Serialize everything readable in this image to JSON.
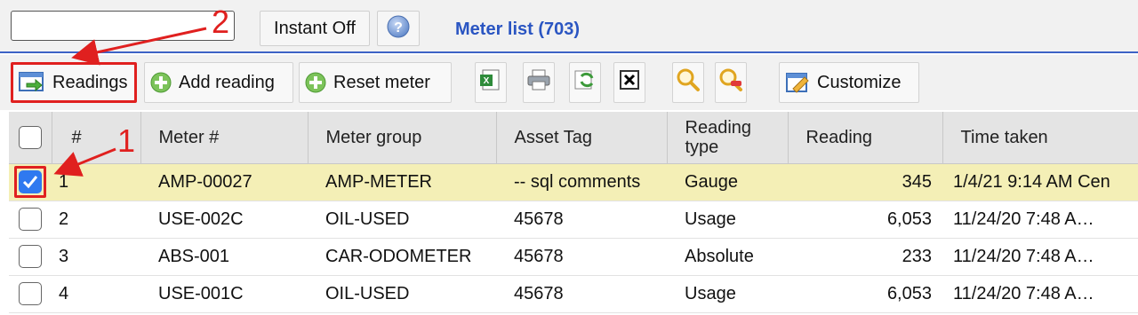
{
  "search": {
    "value": "",
    "placeholder": ""
  },
  "topbar": {
    "instant_label": "Instant Off",
    "help_icon": "help-icon",
    "title": "Meter list (703)"
  },
  "toolbar": {
    "readings_label": "Readings",
    "add_reading_label": "Add reading",
    "reset_meter_label": "Reset meter",
    "customize_label": "Customize",
    "icons": [
      "excel-export-icon",
      "print-icon",
      "refresh-icon",
      "close-icon",
      "search-icon",
      "clear-search-icon",
      "customize-icon"
    ]
  },
  "grid": {
    "columns": [
      "#",
      "Meter #",
      "Meter group",
      "Asset Tag",
      "Reading type",
      "Reading",
      "Time taken"
    ],
    "rows": [
      {
        "index": "1",
        "meter": "AMP-00027",
        "group": "AMP-METER",
        "asset": "-- sql comments",
        "type": "Gauge",
        "reading": "345",
        "time": "1/4/21 9:14 AM Cen",
        "checked": true
      },
      {
        "index": "2",
        "meter": "USE-002C",
        "group": "OIL-USED",
        "asset": "45678",
        "type": "Usage",
        "reading": "6,053",
        "time": "11/24/20 7:48 A…",
        "checked": false
      },
      {
        "index": "3",
        "meter": "ABS-001",
        "group": "CAR-ODOMETER",
        "asset": "45678",
        "type": "Absolute",
        "reading": "233",
        "time": "11/24/20 7:48 A…",
        "checked": false
      },
      {
        "index": "4",
        "meter": "USE-001C",
        "group": "OIL-USED",
        "asset": "45678",
        "type": "Usage",
        "reading": "6,053",
        "time": "11/24/20 7:48 A…",
        "checked": false
      }
    ]
  },
  "annotations": {
    "step1": "1",
    "step2": "2"
  },
  "colors": {
    "accent": "#2a55c2",
    "highlight": "#e0201f",
    "selected_row": "#f4efb6",
    "checkbox_checked": "#2f79f0"
  }
}
